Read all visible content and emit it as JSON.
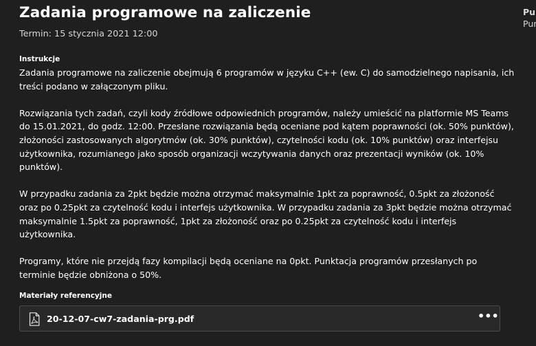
{
  "assignment": {
    "title": "Zadania programowe na zaliczenie",
    "due": "Termin: 15 stycznia 2021 12:00"
  },
  "instructions": {
    "label": "Instrukcje",
    "paragraphs": [
      "Zadania programowe na zaliczenie obejmują 6 programów w języku C++ (ew. C) do samodzielnego napisania, ich\ntreści podano w załączonym pliku.",
      "Rozwiązania tych zadań, czyli kody źródłowe odpowiednich programów, należy umieścić na platformie MS Teams\ndo 15.01.2021, do godz. 12:00. Przesłane rozwiązania będą oceniane pod kątem poprawności (ok. 50% punktów),\nzłożoności zastosowanych algorytmów (ok. 30% punktów), czytelności kodu (ok. 10% punktów) oraz interfejsu\nużytkownika, rozumianego jako sposób organizacji wczytywania danych oraz prezentacji wyników (ok. 10%\npunktów).",
      "W przypadku zadania za 2pkt będzie można otrzymać maksymalnie 1pkt za poprawność, 0.5pkt za złożoność\noraz po 0.25pkt za czytelność kodu i interfejs użytkownika. W przypadku zadania za 3pkt będzie można otrzymać\nmaksymalnie 1.5pkt za poprawność, 1pkt za złożoność oraz po 0.25pkt za czytelność kodu i interfejs\nużytkownika.",
      "Programy, które nie przejdą fazy kompilacji będą oceniane na 0pkt. Punktacja programów przesłanych po\nterminie będzie obniżona o 50%."
    ]
  },
  "materials": {
    "label": "Materiały referencyjne",
    "file": {
      "name": "20-12-07-cw7-zadania-prg.pdf",
      "icon": "pdf-file-icon",
      "more_label": "•••"
    }
  },
  "side_panel": {
    "line1": "Pun",
    "line2": "Pun"
  }
}
